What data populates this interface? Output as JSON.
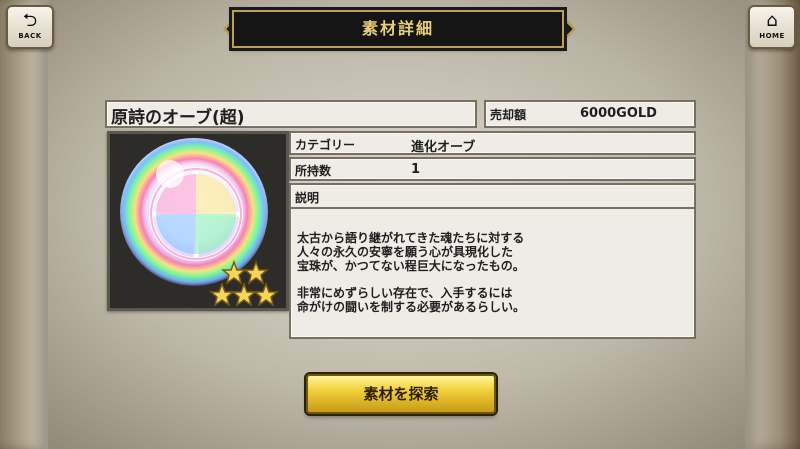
{
  "nav": {
    "back_label": "BACK",
    "back_icon": "back-arrow-icon",
    "home_label": "HOME",
    "home_icon": "home-icon"
  },
  "header": {
    "title": "素材詳細"
  },
  "item": {
    "name": "原詩のオーブ(超)",
    "sell_price_label": "売却額",
    "sell_price_value": "6000GOLD",
    "category_label": "カテゴリー",
    "category_value": "進化オーブ",
    "owned_label": "所持数",
    "owned_value": "1",
    "description_label": "説明",
    "description_lines": [
      "太古から語り継がれてきた魂たちに対する",
      "人々の永久の安寧を願う心が具現化した",
      "宝珠が、かつてない程巨大になったもの。",
      "非常にめずらしい存在で、入手するには",
      "命がけの闘いを制する必要があるらしい。"
    ],
    "rarity_stars": 5,
    "icon": "rainbow-orb-icon"
  },
  "actions": {
    "search_label": "素材を探索"
  },
  "colors": {
    "banner_gold": "#e9cf7a",
    "button_gold": "#f1d03b",
    "star_gold": "#f3d55a"
  }
}
